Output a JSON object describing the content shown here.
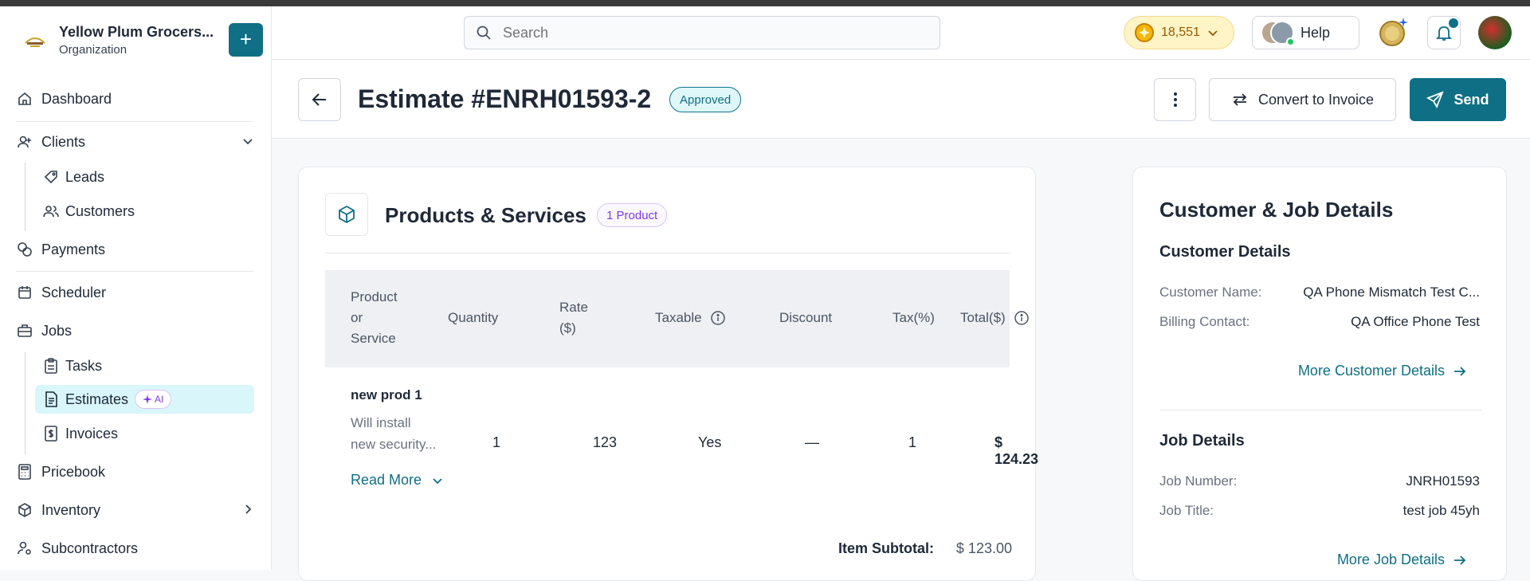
{
  "organization": {
    "name": "Yellow Plum Grocers...",
    "subtitle": "Organization",
    "add_label": "+"
  },
  "sidebar": {
    "dashboard": "Dashboard",
    "clients": "Clients",
    "leads": "Leads",
    "customers": "Customers",
    "payments": "Payments",
    "scheduler": "Scheduler",
    "jobs": "Jobs",
    "tasks": "Tasks",
    "estimates": "Estimates",
    "ai_badge": "AI",
    "invoices": "Invoices",
    "pricebook": "Pricebook",
    "inventory": "Inventory",
    "subcontractors": "Subcontractors"
  },
  "topbar": {
    "search_placeholder": "Search",
    "coins": "18,551",
    "help": "Help"
  },
  "page": {
    "title": "Estimate #ENRH01593-2",
    "status": "Approved",
    "convert_label": "Convert to Invoice",
    "send_label": "Send"
  },
  "products": {
    "title": "Products & Services",
    "count": "1 Product",
    "columns": {
      "product_line1": "Product",
      "product_line2": "or",
      "product_line3": "Service",
      "quantity": "Quantity",
      "rate_line1": "Rate",
      "rate_line2": "($)",
      "taxable": "Taxable",
      "discount": "Discount",
      "tax": "Tax(%)",
      "total": "Total($)"
    },
    "row": {
      "name": "new prod 1",
      "desc_line1": "Will install",
      "desc_line2": "new security...",
      "quantity": "1",
      "rate": "123",
      "taxable": "Yes",
      "discount": "—",
      "tax": "1",
      "total": "$ 124.23"
    },
    "read_more": "Read More",
    "subtotal_label": "Item Subtotal:",
    "subtotal_value": "$ 123.00"
  },
  "customer": {
    "title": "Customer & Job Details",
    "customer_section": "Customer Details",
    "name_label": "Customer Name:",
    "name_value": "QA Phone Mismatch Test C...",
    "billing_label": "Billing Contact:",
    "billing_value": "QA Office Phone Test",
    "more_customer": "More Customer Details",
    "job_section": "Job Details",
    "job_number_label": "Job Number:",
    "job_number_value": "JNRH01593",
    "job_title_label": "Job Title:",
    "job_title_value": "test job 45yh",
    "more_job": "More Job Details"
  },
  "colors": {
    "accent": "#0e6f85",
    "active_bg": "#d9f6fb",
    "ai": "#7c3aed",
    "coins_bg": "#fff4c6"
  }
}
